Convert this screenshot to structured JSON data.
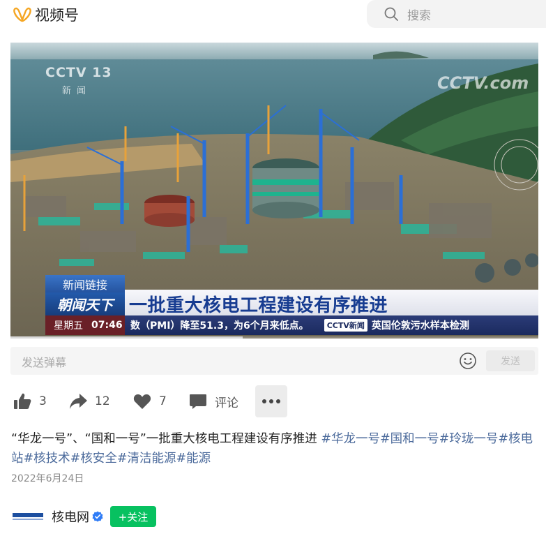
{
  "header": {
    "app_name": "视频号",
    "search_placeholder": "搜索"
  },
  "video": {
    "watermark_top_left": "CCTV 13",
    "watermark_top_left_sub": "新闻",
    "watermark_top_right": "CCTV.com",
    "news_tag": "新闻链接",
    "program_name": "朝闻天下",
    "headline": "一批重大核电工程建设有序推进",
    "weekday": "星期五",
    "time": "07:46",
    "ticker_text": "数（PMI）降至51.3，为6个月来低点。",
    "ticker_logo": "CCTV新闻",
    "ticker_next": "英国伦敦污水样本检测",
    "progress_fraction": 0.44
  },
  "danmu": {
    "placeholder": "发送弹幕",
    "send_label": "发送"
  },
  "actions": {
    "like_count": "3",
    "share_count": "12",
    "favorite_count": "7",
    "comment_label": "评论",
    "more_label": "•••"
  },
  "post": {
    "title": "“华龙一号”、“国和一号”一批重大核电工程建设有序推进",
    "tags": "#华龙一号#国和一号#玲珑一号#核电站#核技术#核安全#清洁能源#能源",
    "date": "2022年6月24日"
  },
  "author": {
    "name": "核电网",
    "follow_label": "+关注"
  },
  "colors": {
    "follow_green": "#07c160",
    "tag_blue": "#4b6a9b",
    "verified_blue": "#2f7cf6"
  }
}
